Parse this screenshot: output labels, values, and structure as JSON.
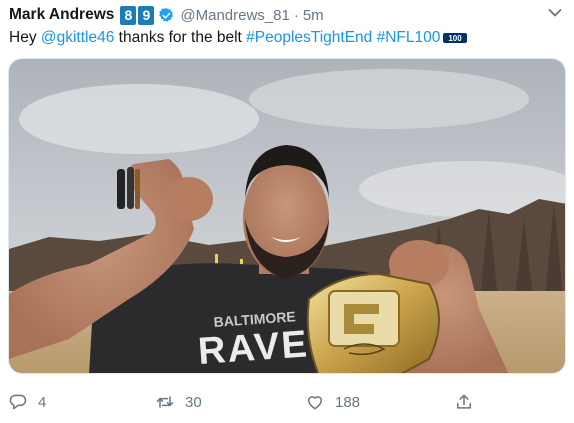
{
  "tweet": {
    "author_name": "Mark Andrews",
    "jersey_digits": [
      "8",
      "9"
    ],
    "handle": "@Mandrews_81",
    "separator": "·",
    "time": "5m",
    "text_prefix": "Hey ",
    "mention": "@gkittle46",
    "text_middle": " thanks for the belt ",
    "hashtag_1": "#PeoplesTightEnd",
    "hashtag_2": "#NFL100",
    "nfl_emoji_label": "100"
  },
  "photo": {
    "shirt_line1": "BALTIMORE",
    "shirt_line2": "RAVE"
  },
  "actions": {
    "reply_count": "4",
    "retweet_count": "30",
    "like_count": "188"
  },
  "colors": {
    "link": "#1b95e0",
    "secondary": "#657786",
    "verified": "#1da1f2",
    "jersey_badge": "#1d7bb8"
  },
  "icons": [
    "verified-badge-icon",
    "caret-down-icon",
    "reply-icon",
    "retweet-icon",
    "like-icon",
    "share-icon"
  ]
}
